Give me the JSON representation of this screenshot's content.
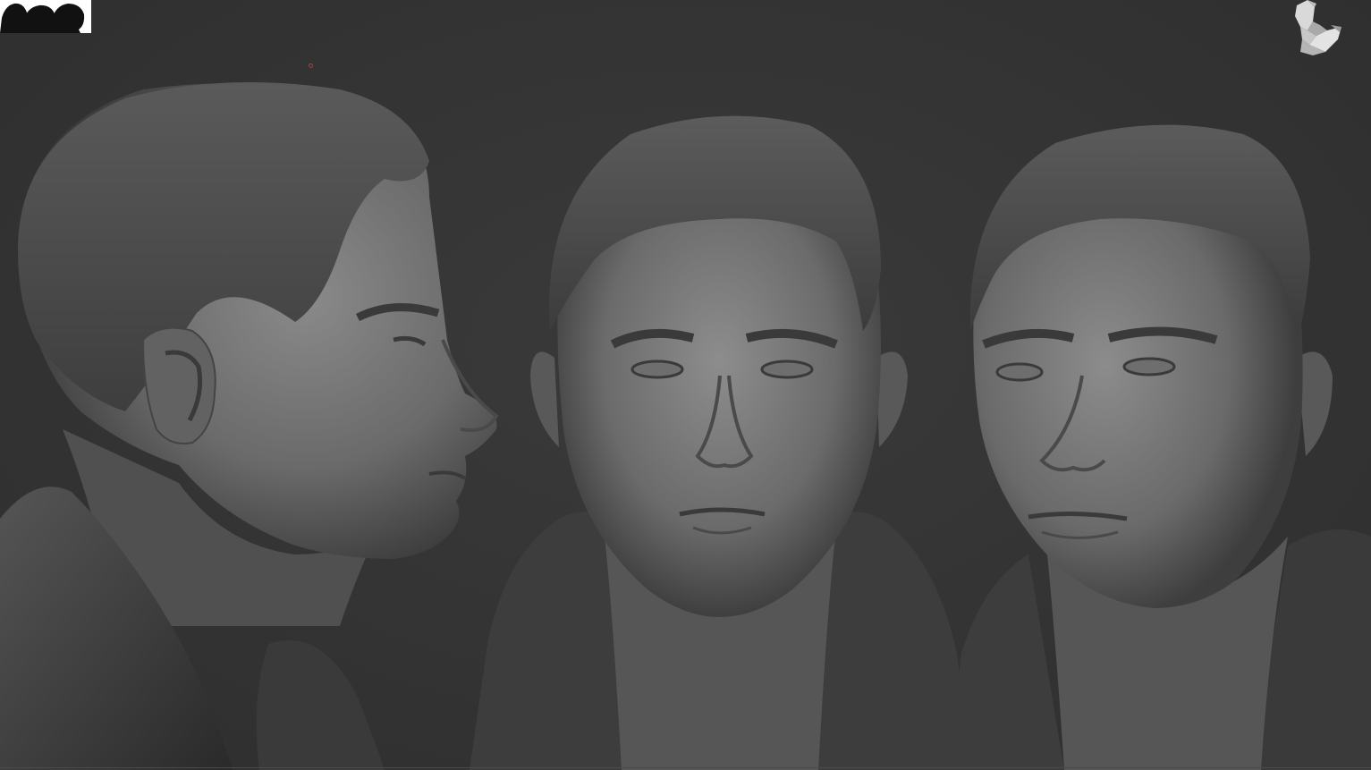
{
  "viewport": {
    "background_color": "#333333",
    "mesh_color": "#6f6f6f",
    "shadow_color": "#1e1e1e",
    "cursor_color": "#c0392b"
  },
  "navigator": {
    "icon": "head-silhouettes-icon"
  },
  "orientation_gizmo": {
    "icon": "head-orientation-icon"
  },
  "views": [
    {
      "name": "side-profile-view",
      "icon": "sculpted-head-profile"
    },
    {
      "name": "front-view",
      "icon": "sculpted-head-front"
    },
    {
      "name": "three-quarter-view",
      "icon": "sculpted-head-three-quarter"
    }
  ]
}
